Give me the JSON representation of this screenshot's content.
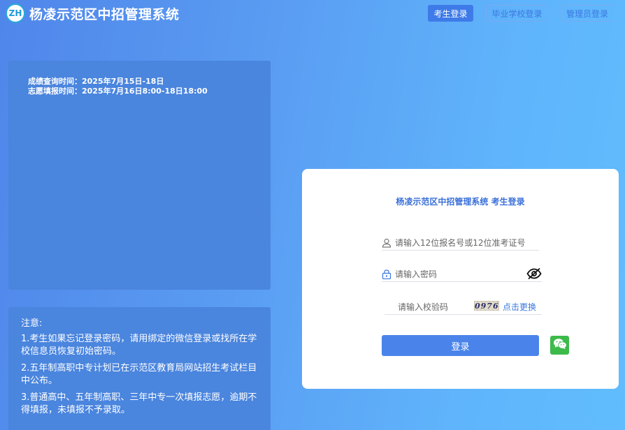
{
  "header": {
    "logo_text": "ZH",
    "title": "杨凌示范区中招管理系统",
    "nav": {
      "student_login": "考生登录",
      "school_login": "毕业学校登录",
      "admin_login": "管理员登录"
    }
  },
  "schedule": {
    "line1": "成绩查询时间：2025年7月15日-18日",
    "line2": "志愿填报时间：2025年7月16日8:00-18日18:00"
  },
  "notice": {
    "title": "注意:",
    "items": [
      "1.考生如果忘记登录密码，请用绑定的微信登录或找所在学校信息员恢复初始密码。",
      "2.五年制高职中专计划已在示范区教育局网站招生考试栏目中公布。",
      "3.普通高中、五年制高职、三年中专一次填报志愿，逾期不得填报，未填报不予录取。"
    ]
  },
  "login": {
    "title": "杨凌示范区中招管理系统 考生登录",
    "account_placeholder": "请输入12位报名号或12位准考证号",
    "password_placeholder": "请输入密码",
    "captcha_placeholder": "请输入校验码",
    "captcha_text": "0976",
    "refresh_label": "点击更换",
    "submit_label": "登录"
  },
  "icons": {
    "user": "user-icon",
    "lock": "lock-icon",
    "eye": "eye-slash-icon",
    "wechat": "wechat-icon"
  },
  "colors": {
    "accent": "#4a84ea",
    "link": "#3a78e0",
    "wechat": "#3cba4a"
  }
}
